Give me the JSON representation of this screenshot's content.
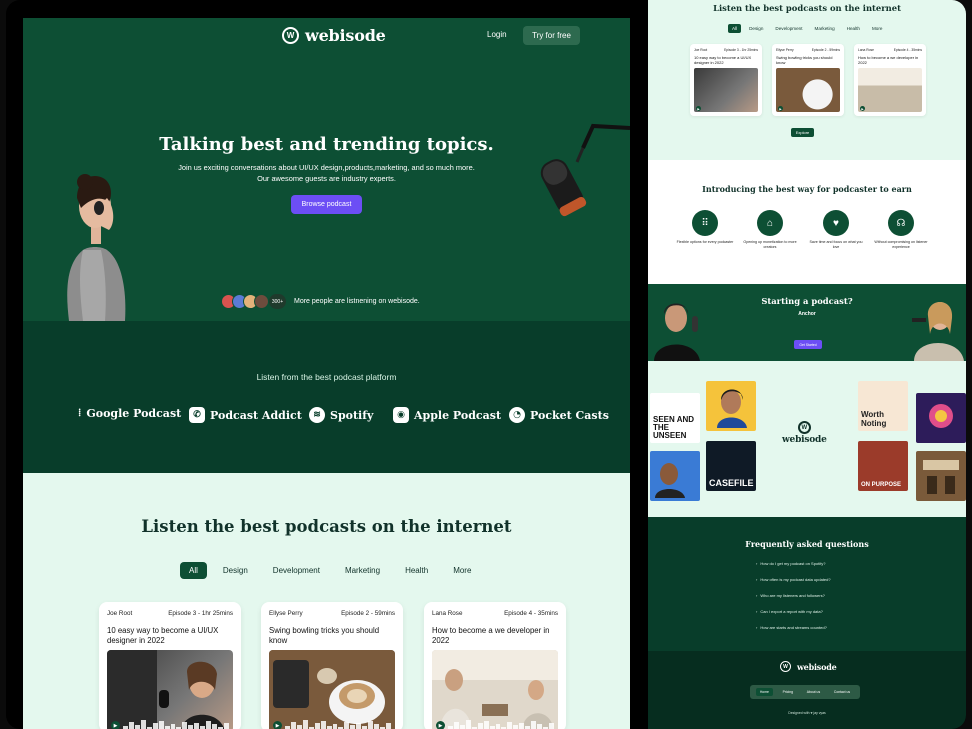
{
  "brand": {
    "name": "webisode",
    "badge": "W"
  },
  "nav": {
    "login": "Login",
    "cta": "Try for free"
  },
  "hero": {
    "title": "Talking best and trending topics.",
    "subtitle_line1": "Join us exciting conversations about UI/UX design,products,marketing, and so much more.",
    "subtitle_line2": "Our awesome guests are industry experts.",
    "cta": "Browse podcast",
    "avatar_count": "300+",
    "avatar_text": "More people are listnening on webisode."
  },
  "platforms": {
    "title": "Listen from the best podcast platform",
    "items": [
      {
        "name": "Google Podcast",
        "icon": "google-podcast-icon",
        "glyph": "⁞"
      },
      {
        "name": "Podcast Addict",
        "icon": "podcast-addict-icon",
        "glyph": "✆"
      },
      {
        "name": "Spotify",
        "icon": "spotify-icon",
        "glyph": "≋"
      },
      {
        "name": "Apple Podcast",
        "icon": "apple-podcast-icon",
        "glyph": "◉"
      },
      {
        "name": "Pocket Casts",
        "icon": "pocket-casts-icon",
        "glyph": "◔"
      }
    ]
  },
  "episodes": {
    "title": "Listen the best podcasts on the internet",
    "tabs": [
      "All",
      "Design",
      "Development",
      "Marketing",
      "Health",
      "More"
    ],
    "active_tab": "All",
    "cards": [
      {
        "host": "Joe Root",
        "episode": "Episode 3 - 1hr 25mins",
        "title": "10 easy way to become a UI/UX designer in 2022"
      },
      {
        "host": "Ellyse Perry",
        "episode": "Episode 2 - 59mins",
        "title": "Swing bowling tricks you should know"
      },
      {
        "host": "Lana Rose",
        "episode": "Episode 4 - 35mins",
        "title": "How to become a we developer in 2022"
      }
    ],
    "explore": "Explore"
  },
  "earn": {
    "title": "Introducing the best way for podcaster to earn",
    "features": [
      {
        "title": "Flexible options for every podcaster",
        "icon": "grid-icon"
      },
      {
        "title": "Opening up monetization to more creators",
        "icon": "store-icon"
      },
      {
        "title": "Save time and focus on what you love",
        "icon": "chat-icon"
      },
      {
        "title": "Without compromising on listener experience",
        "icon": "headphones-icon"
      }
    ]
  },
  "anchor": {
    "title": "Starting a podcast?",
    "name": "Anchor",
    "cta": "Get Started"
  },
  "covers": [
    {
      "label": "SEEN AND THE UNSEEN",
      "bg": "#ffffff",
      "fg": "#111111"
    },
    {
      "label": "",
      "bg": "#f5c33b",
      "fg": "#111111"
    },
    {
      "label": "",
      "bg": "#3a7bd5",
      "fg": "#ffffff"
    },
    {
      "label": "CASEFILE",
      "bg": "#0f1a26",
      "fg": "#ffffff"
    },
    {
      "label": "Worth Noting",
      "bg": "#f7e7d4",
      "fg": "#222222"
    },
    {
      "label": "",
      "bg": "#2d1c5a",
      "fg": "#ffffff"
    },
    {
      "label": "ON PURPOSE",
      "bg": "#9b3b2a",
      "fg": "#ffffff"
    },
    {
      "label": "",
      "bg": "#7a5a3a",
      "fg": "#ffffff"
    }
  ],
  "faq": {
    "title": "Frequently asked questions",
    "items": [
      "How do I get my podcast on Spotify?",
      "How often is my podcast data updated?",
      "Who are my listeners and followers?",
      "Can I export a report with my data?",
      "How are starts and streams counted?"
    ]
  },
  "footer": {
    "nav": [
      "Home",
      "Pricing",
      "About us",
      "Contact us"
    ],
    "active": "Home",
    "credit": "Designed with ♥ jay vyas"
  },
  "colors": {
    "primary": "#0d4f34",
    "dark": "#083d2a",
    "mint": "#e4f8ee",
    "accent": "#6c4ef5"
  }
}
